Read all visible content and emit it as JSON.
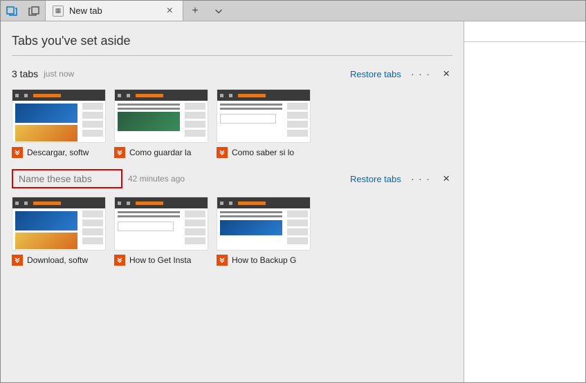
{
  "titlebar": {
    "tab_label": "New tab"
  },
  "page": {
    "title": "Tabs you've set aside"
  },
  "groups": [
    {
      "count_label": "3 tabs",
      "age": "just now",
      "restore_label": "Restore tabs",
      "name_input_shown": false,
      "tabs": [
        {
          "title": "Descargar, softw"
        },
        {
          "title": "Como guardar la"
        },
        {
          "title": "Como saber si lo"
        }
      ]
    },
    {
      "name_placeholder": "Name these tabs",
      "age": "42 minutes ago",
      "restore_label": "Restore tabs",
      "name_input_shown": true,
      "tabs": [
        {
          "title": "Download, softw"
        },
        {
          "title": "How to Get Insta"
        },
        {
          "title": "How to Backup G"
        }
      ]
    }
  ],
  "colors": {
    "accent": "#0067b8",
    "badge": "#e74c0a",
    "highlight_border": "#e00000"
  }
}
